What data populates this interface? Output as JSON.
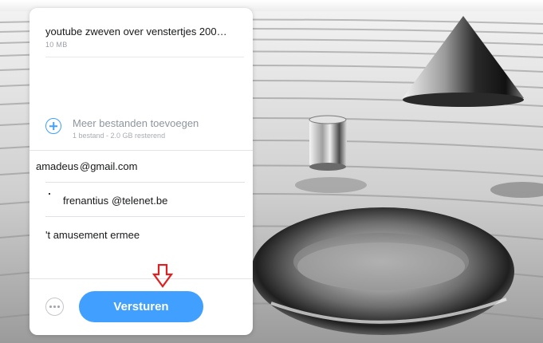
{
  "file": {
    "name": "youtube zweven over venstertjes 200…",
    "size": "10 MB"
  },
  "add_files": {
    "title": "Meer bestanden toevoegen",
    "subtitle": "1 bestand - 2.0 GB resterend"
  },
  "email_to": {
    "user": "amadeus",
    "domain": "@gmail.com"
  },
  "email_from": {
    "user": "frenantius",
    "domain": "@telenet.be"
  },
  "message": "'t amusement ermee",
  "actions": {
    "more_icon": "more-horizontal-icon",
    "send_label": "Versturen"
  },
  "colors": {
    "accent": "#409fff",
    "annotation_arrow": "#e02020"
  }
}
